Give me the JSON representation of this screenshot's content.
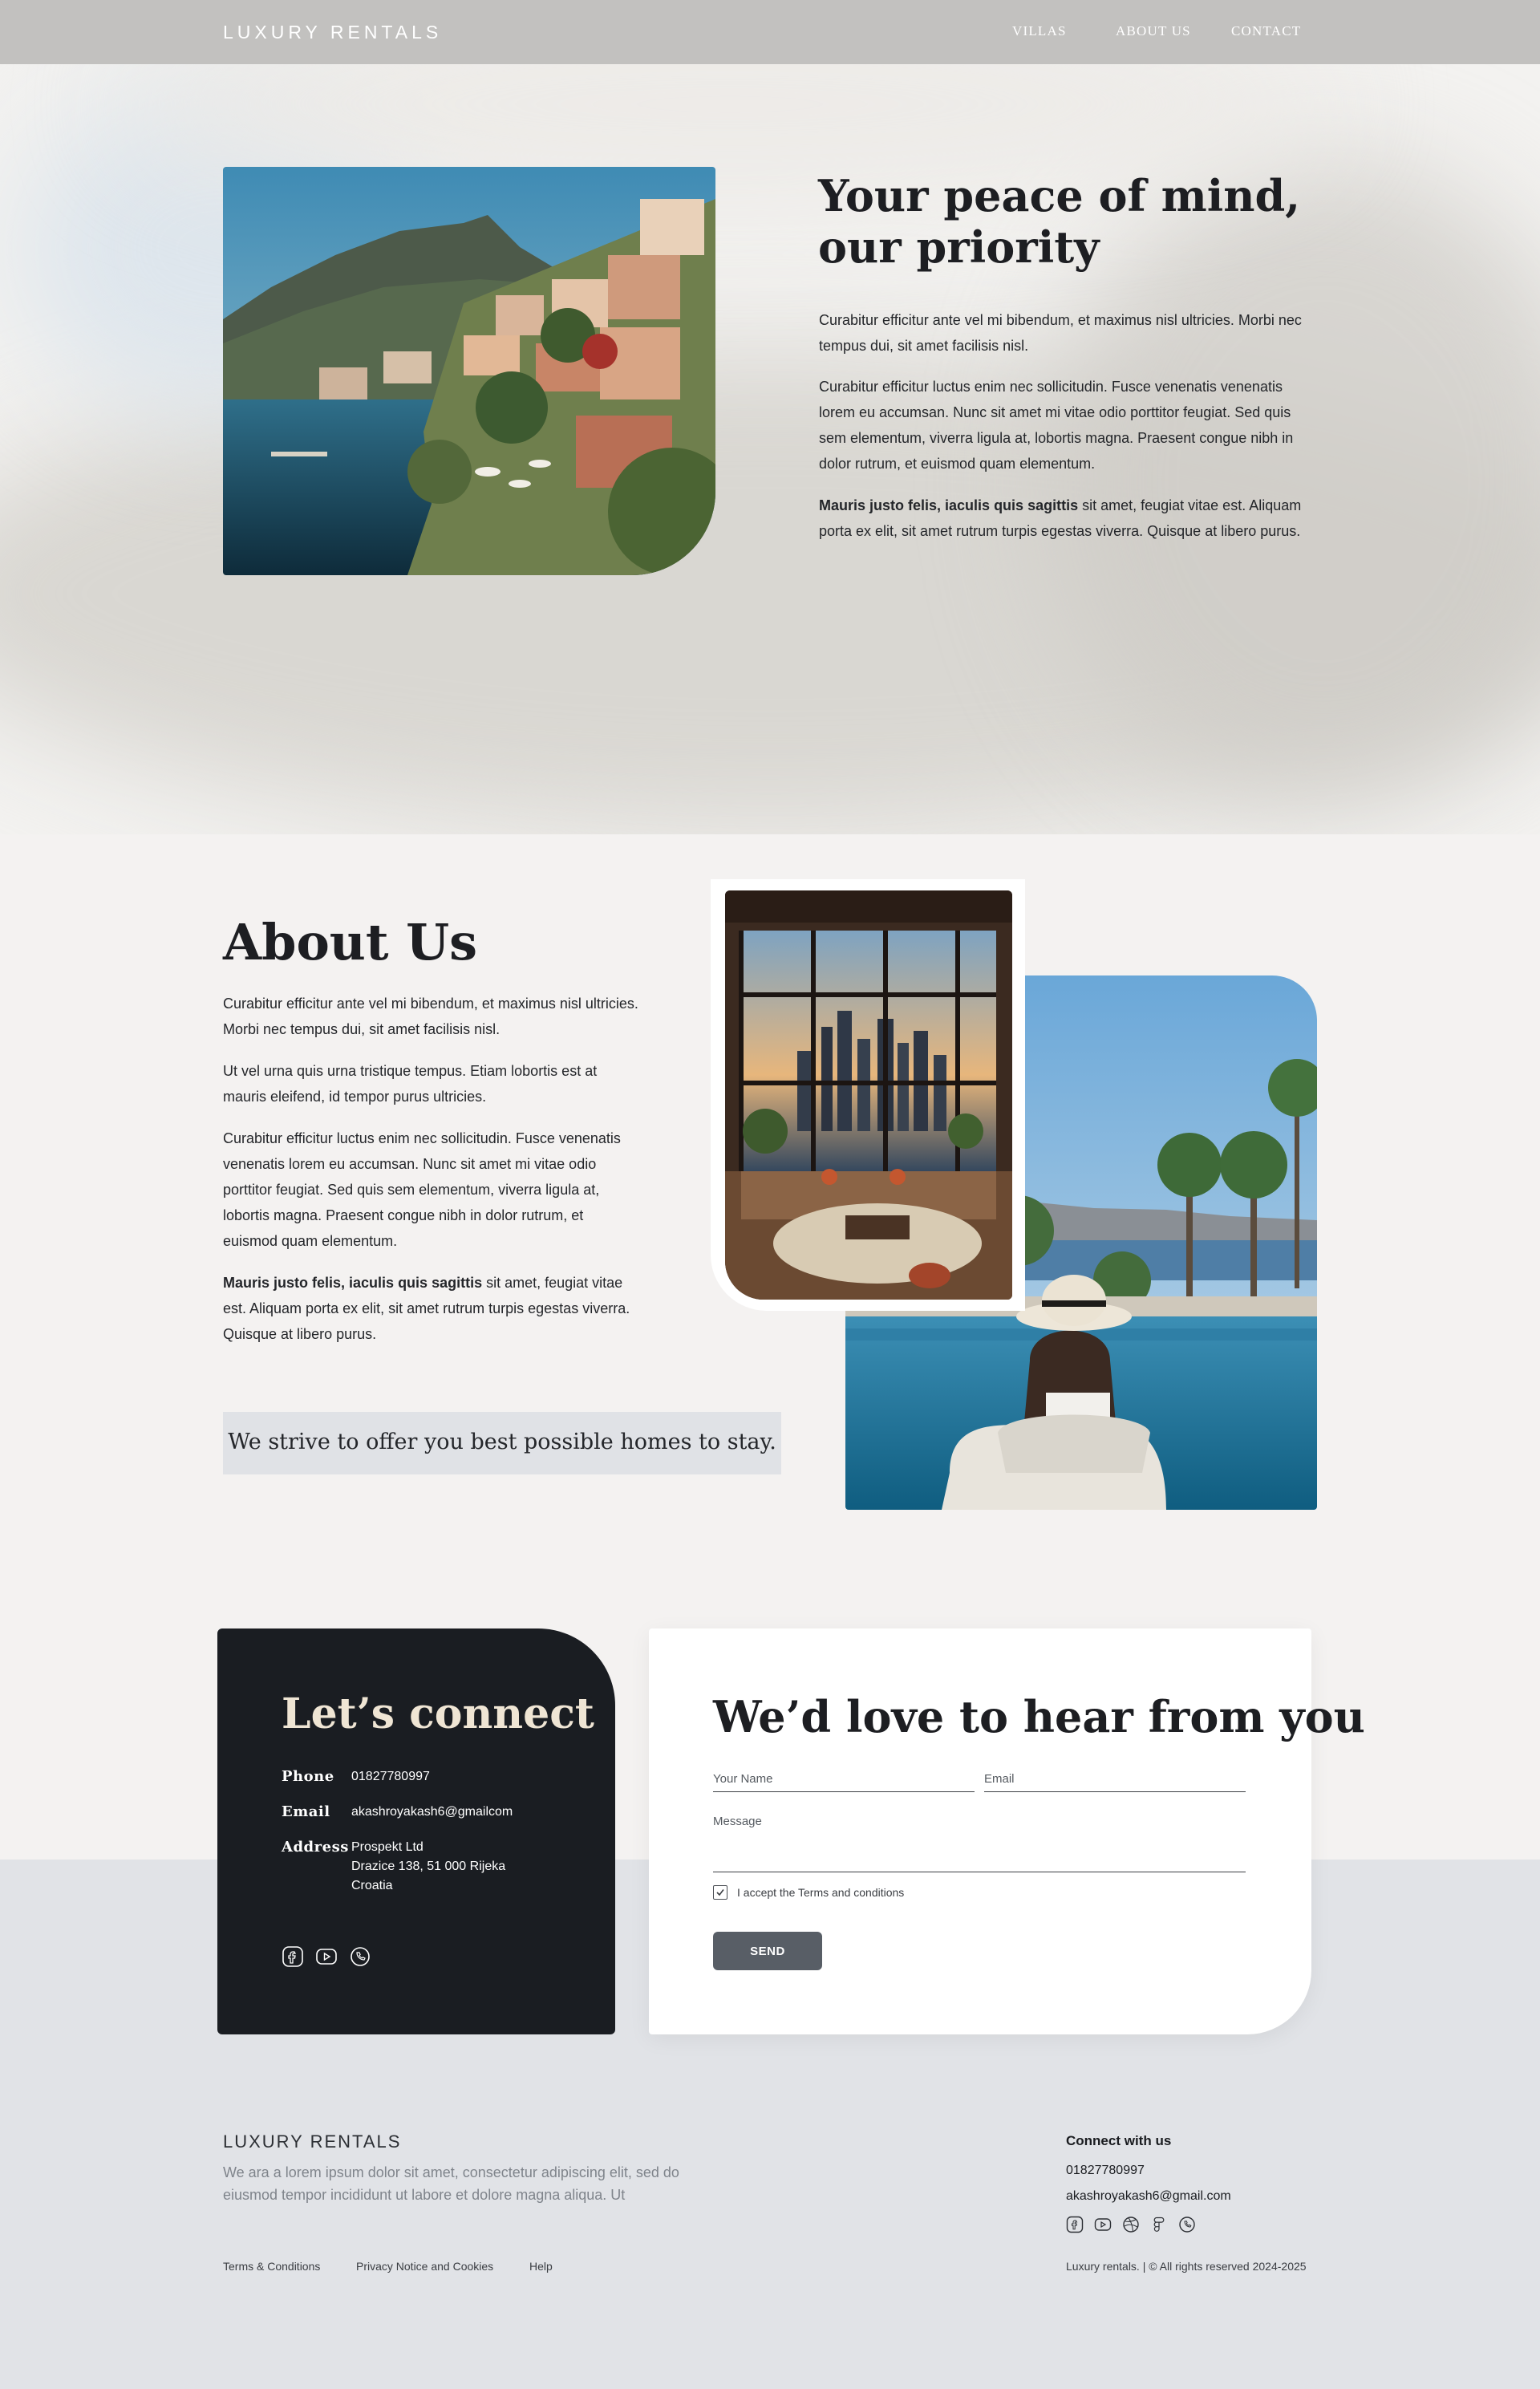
{
  "header": {
    "brand": "LUXURY RENTALS",
    "nav": [
      {
        "label": "VILLAS"
      },
      {
        "label": "ABOUT US"
      },
      {
        "label": "CONTACT"
      }
    ]
  },
  "hero": {
    "title_line1": "Your peace of mind,",
    "title_line2": "our priority",
    "p1": "Curabitur efficitur ante vel mi bibendum, et maximus nisl ultricies. Morbi nec tempus dui, sit amet facilisis nisl.",
    "p2": "Curabitur efficitur luctus enim nec sollicitudin. Fusce venenatis venenatis lorem eu accumsan. Nunc sit amet mi vitae odio porttitor feugiat. Sed quis sem elementum, viverra ligula at, lobortis magna. Praesent congue nibh in dolor rutrum, et euismod quam elementum.",
    "p3_bold": "Mauris justo felis, iaculis quis sagittis",
    "p3_rest": " sit amet, feugiat vitae est. Aliquam porta ex elit, sit amet rutrum turpis egestas viverra. Quisque at libero purus."
  },
  "about": {
    "title": "About Us",
    "p1": "Curabitur efficitur ante vel mi bibendum, et maximus nisl ultricies. Morbi nec tempus dui, sit amet facilisis nisl.",
    "p2": "Ut vel urna quis urna tristique tempus. Etiam lobortis est at mauris eleifend, id tempor purus ultricies.",
    "p3": "Curabitur efficitur luctus enim nec sollicitudin. Fusce venenatis venenatis lorem eu accumsan. Nunc sit amet mi vitae odio porttitor feugiat. Sed quis sem elementum, viverra ligula at, lobortis magna. Praesent congue nibh in dolor rutrum, et euismod quam elementum.",
    "p4_bold": "Mauris justo felis, iaculis quis sagittis",
    "p4_rest": " sit amet, feugiat vitae est. Aliquam porta ex elit, sit amet rutrum turpis egestas viverra. Quisque at libero purus.",
    "quote": "We strive to offer you best possible homes to stay."
  },
  "connect": {
    "title": "Let’s connect",
    "phone_label": "Phone",
    "phone": "01827780997",
    "email_label": "Email",
    "email": "akashroyakash6@gmailcom",
    "address_label": "Address",
    "address_line1": "Prospekt Ltd",
    "address_line2": "Drazice 138, 51 000 Rijeka",
    "address_line3": "Croatia",
    "socials": [
      "facebook-icon",
      "youtube-icon",
      "whatsapp-icon"
    ]
  },
  "form": {
    "title": "We’d love to hear from you",
    "name_placeholder": "Your Name",
    "email_placeholder": "Email",
    "message_placeholder": "Message",
    "terms_label": "I accept the Terms and conditions",
    "terms_checked": true,
    "send_label": "SEND"
  },
  "footer": {
    "brand": "LUXURY RENTALS",
    "description": "We ara a lorem ipsum dolor sit amet, consectetur adipiscing elit, sed do eiusmod tempor incididunt ut labore et dolore magna aliqua. Ut",
    "connect_heading": "Connect with us",
    "phone": "01827780997",
    "email": "akashroyakash6@gmail.com",
    "socials": [
      "facebook-icon",
      "youtube-icon",
      "dribbble-icon",
      "figma-icon",
      "whatsapp-icon"
    ],
    "links": [
      {
        "label": "Terms & Conditions"
      },
      {
        "label": "Privacy Notice and Cookies"
      },
      {
        "label": "Help"
      }
    ],
    "copyright": "Luxury rentals. | © All rights reserved 2024-2025"
  },
  "colors": {
    "header_bg": "#c2c1bf",
    "dark_card": "#1a1d22",
    "accent_cream": "#efe5d4",
    "button": "#585e66",
    "footer_bg": "#e1e3e7"
  }
}
